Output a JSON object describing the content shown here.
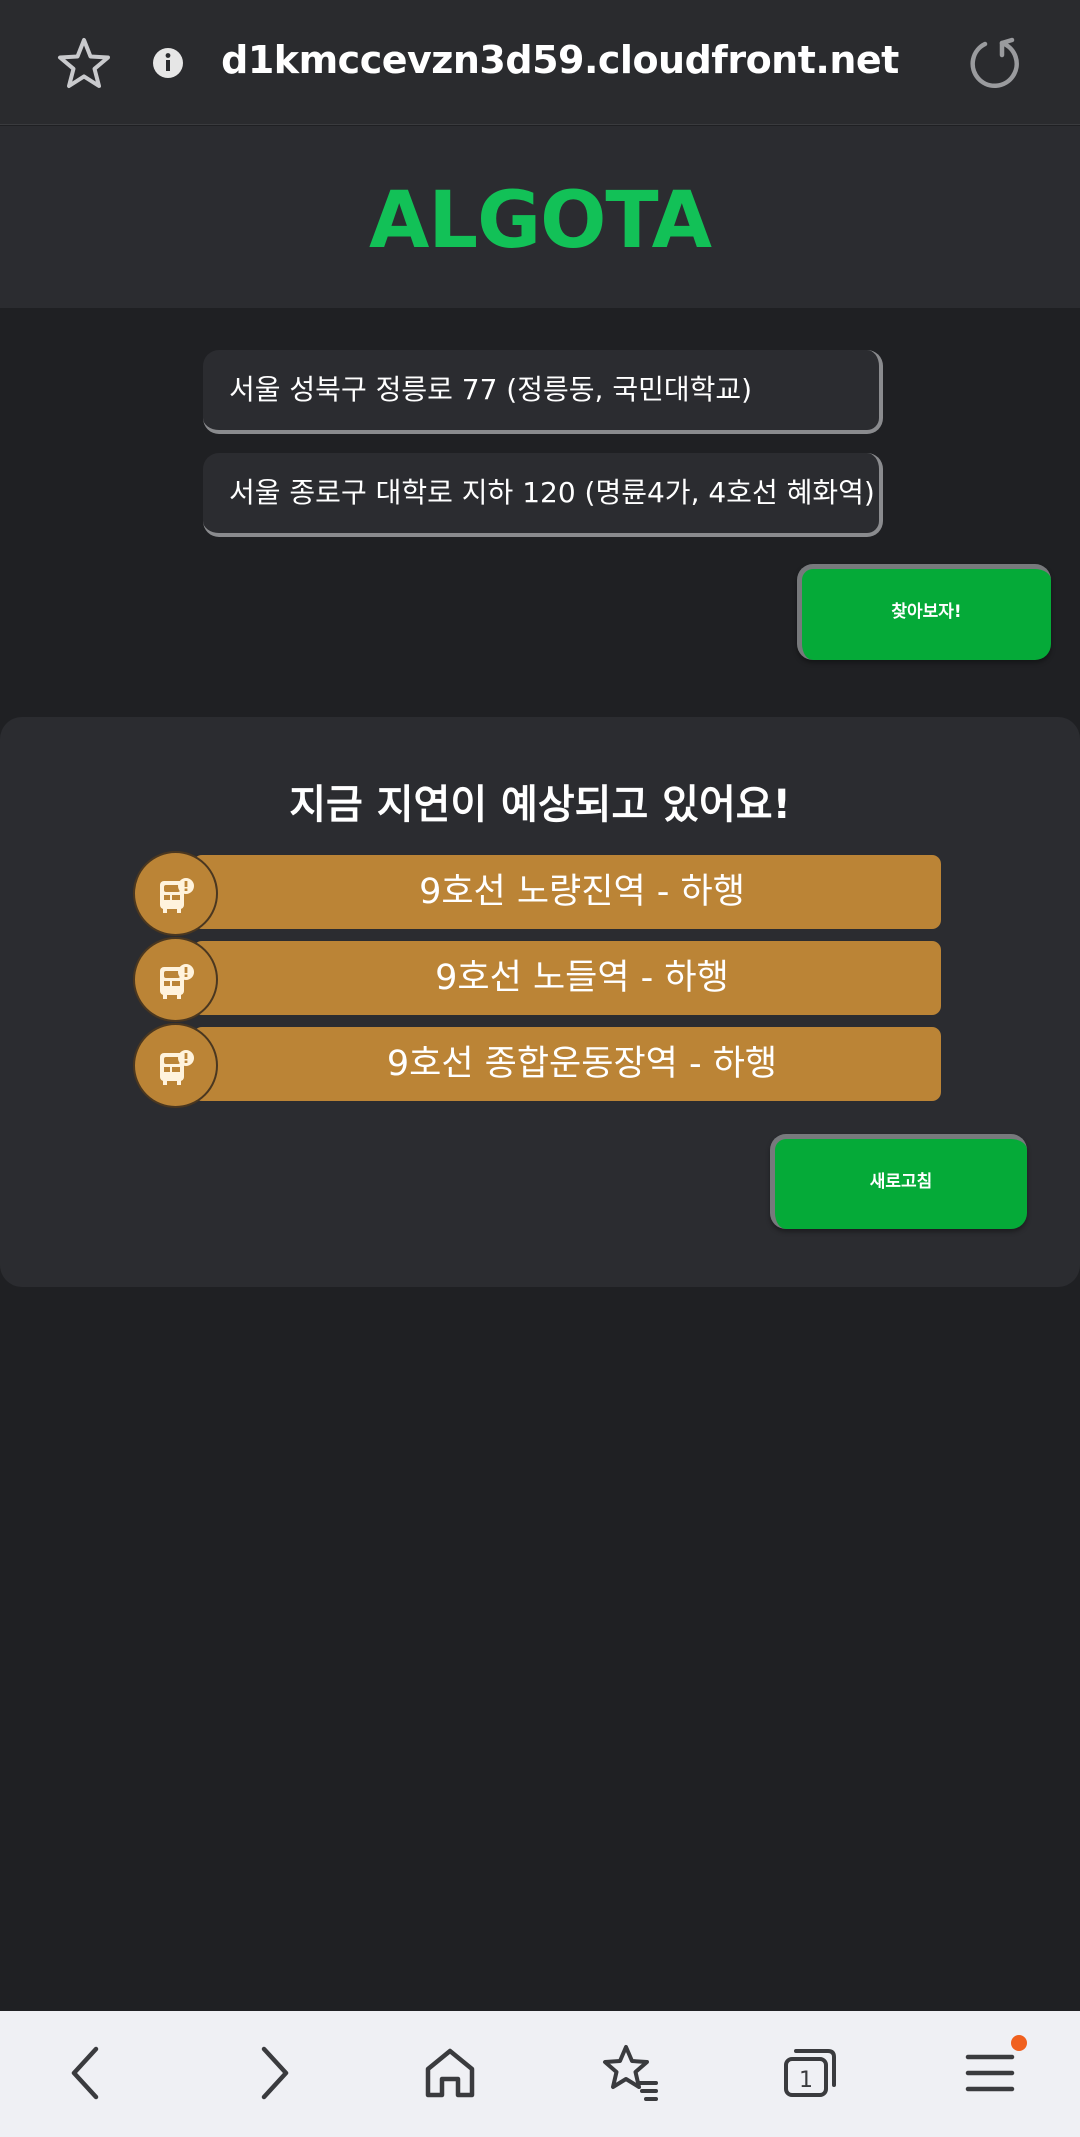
{
  "browser": {
    "url": "d1kmccevzn3d59.cloudfront.net",
    "tab_count": "1"
  },
  "app": {
    "title": "ALGOTA"
  },
  "search": {
    "origin": "서울 성북구 정릉로 77 (정릉동, 국민대학교)",
    "destination": "서울 종로구 대학로 지하 120 (명륜4가, 4호선 혜화역)",
    "submit_label": "찾아보자!"
  },
  "delays": {
    "title": "지금 지연이 예상되고 있어요!",
    "items": [
      {
        "label": "9호선 노량진역 - 하행"
      },
      {
        "label": "9호선 노들역 - 하행"
      },
      {
        "label": "9호선 종합운동장역 - 하행"
      }
    ],
    "refresh_label": "새로고침"
  },
  "colors": {
    "brand_green": "#12c157",
    "button_green": "#05aa38",
    "delay_bar": "#bb8436",
    "background": "#1f2023",
    "panel": "#2b2c30"
  }
}
